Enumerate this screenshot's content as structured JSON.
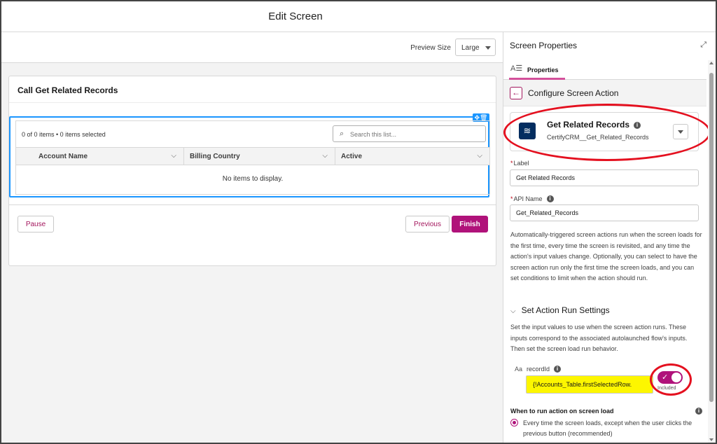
{
  "window": {
    "title": "Edit Screen"
  },
  "preview": {
    "label": "Preview Size",
    "value": "Large"
  },
  "screen": {
    "section_title": "Call Get Related Records",
    "items_count": "0 of 0 items • 0 items selected",
    "search_placeholder": "Search this list...",
    "columns": [
      "Account Name",
      "Billing Country",
      "Active"
    ],
    "empty_text": "No items to display.",
    "buttons": {
      "pause": "Pause",
      "previous": "Previous",
      "finish": "Finish"
    }
  },
  "panel": {
    "title": "Screen Properties",
    "tab": "Properties",
    "section": "Configure Screen Action",
    "action": {
      "name": "Get Related Records",
      "api": "CertifyCRM__Get_Related_Records"
    },
    "label_field": {
      "label": "Label",
      "value": "Get Related Records"
    },
    "api_field": {
      "label": "API Name",
      "value": "Get_Related_Records"
    },
    "description": "Automatically-triggered screen actions run when the screen loads for the first time, every time the screen is revisited, and any time the action's input values change. Optionally, you can select to have the screen action run only the first time the screen loads, and you can set conditions to limit when the action should run.",
    "run_settings_heading": "Set Action Run Settings",
    "run_settings_desc": "Set the input values to use when the screen action runs. These inputs correspond to the associated autolaunched flow's inputs. Then set the screen load run behavior.",
    "param": {
      "name": "recordId",
      "value": "{!Accounts_Table.firstSelectedRow.",
      "toggle_label": "Included",
      "type_icon": "Aa"
    },
    "when_heading": "When to run action on screen load",
    "radio_option": "Every time the screen loads, except when the user clicks the previous button (recommended)"
  },
  "colors": {
    "brand": "#b0127a",
    "highlight": "#fdf600",
    "annotation": "#e4101f",
    "selection": "#1b96ff"
  }
}
